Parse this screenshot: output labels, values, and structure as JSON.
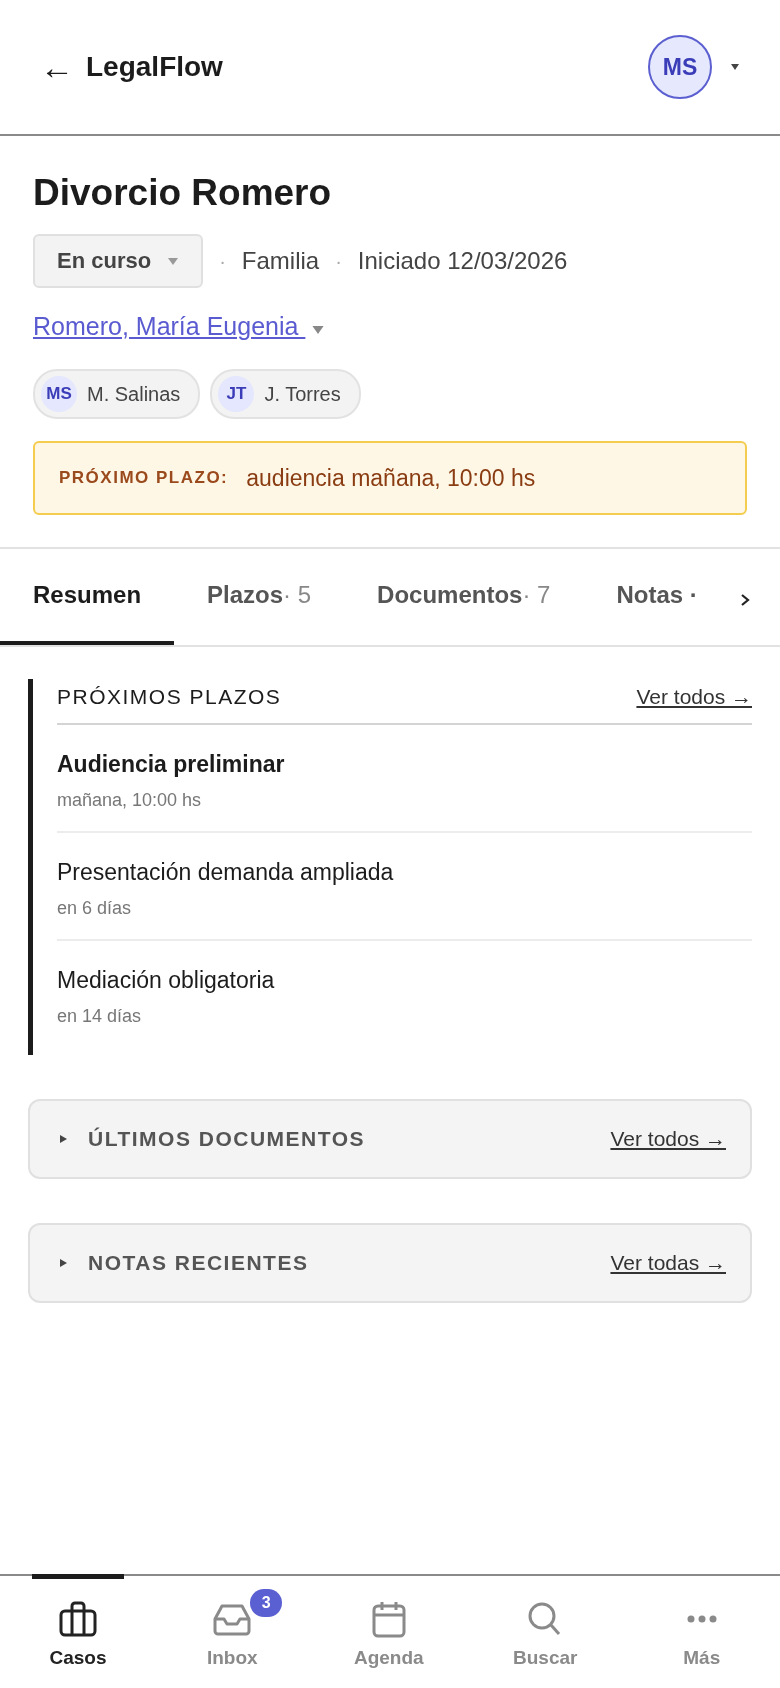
{
  "header": {
    "back": "←",
    "app_name": "LegalFlow",
    "avatar": "MS"
  },
  "case": {
    "title": "Divorcio Romero",
    "status": "En curso",
    "area_separator": "·",
    "area": "Familia",
    "date_separator": "·",
    "started": "Iniciado 12/03/2026",
    "client": "Romero, María Eugenia"
  },
  "team": [
    {
      "initials": "MS",
      "name": "M. Salinas"
    },
    {
      "initials": "JT",
      "name": "J. Torres"
    }
  ],
  "alert": {
    "label": "PRÓXIMO PLAZO:",
    "text": "audiencia mañana, 10:00 hs"
  },
  "tabs": [
    {
      "label": "Resumen",
      "selected": true
    },
    {
      "label": "Plazos",
      "count": "· 5",
      "selected": false
    },
    {
      "label": "Documentos",
      "count": "· 7",
      "selected": false
    },
    {
      "label": "Notas ·",
      "selected": false
    }
  ],
  "sections": [
    {
      "title": "PRÓXIMOS PLAZOS",
      "link": "Ver todos →",
      "expanded": true,
      "items": [
        {
          "title": "Audiencia preliminar",
          "sub": "mañana, 10:00 hs",
          "urgent": true
        },
        {
          "title": "Presentación demanda ampliada",
          "sub": "en 6 días",
          "urgent": false
        },
        {
          "title": "Mediación obligatoria",
          "sub": "en 14 días",
          "urgent": false
        }
      ]
    },
    {
      "title": "ÚLTIMOS DOCUMENTOS",
      "link": "Ver todos →",
      "expanded": false
    },
    {
      "title": "NOTAS RECIENTES",
      "link": "Ver todas →",
      "expanded": false
    }
  ],
  "nav": [
    {
      "kind": "case",
      "label": "Casos",
      "selected": true
    },
    {
      "kind": "inbox",
      "label": "Inbox",
      "badge": "3",
      "selected": false
    },
    {
      "kind": "calendar",
      "label": "Agenda",
      "selected": false
    },
    {
      "kind": "search",
      "label": "Buscar",
      "selected": false
    },
    {
      "kind": "more",
      "label": "Más",
      "selected": false
    }
  ]
}
